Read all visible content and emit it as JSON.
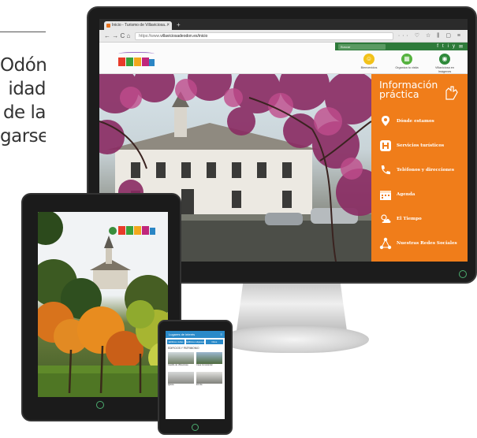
{
  "side_text": {
    "lines": [
      "Odón",
      "idad",
      "de la",
      "garse"
    ]
  },
  "browser": {
    "tab_title": "Inicio - Turismo de Villaviciosa...",
    "tab_close": "×",
    "new_tab": "+",
    "nav_glyphs": "← → C ⌂",
    "url_prefix": "https://www.",
    "url_host": "villaviciosadeodon.es/inicio",
    "tools_glyphs": "··· ♡ ☆   ⫼ ▢ ≡",
    "search_placeholder": "Buscar",
    "utility_icons": [
      "f",
      "t",
      "i",
      "y",
      "✉"
    ]
  },
  "site": {
    "quick_links": [
      {
        "label": "Bienvenidos",
        "icon": "face-icon",
        "color": "#f2c21a"
      },
      {
        "label": "Organiza tu visita",
        "icon": "calendar-icon",
        "color": "#55b23e"
      },
      {
        "label": "Villaviciosa en Imágenes",
        "icon": "camera-icon",
        "color": "#2f8a3b"
      }
    ],
    "info_panel": {
      "title": "Información práctica",
      "items": [
        {
          "label": "Dónde estamos",
          "icon": "location-pin-icon"
        },
        {
          "label": "Servicios turísticos",
          "icon": "hotel-icon"
        },
        {
          "label": "Teléfonos y direcciones",
          "icon": "phone-icon"
        },
        {
          "label": "Agenda",
          "icon": "calendar-icon"
        },
        {
          "label": "El Tiempo",
          "icon": "weather-icon"
        },
        {
          "label": "Nuestras Redes Sociales",
          "icon": "share-icon"
        }
      ]
    },
    "accent_color": "#f07d1a",
    "brand_green": "#2e7a3a"
  },
  "phone": {
    "app_title": "Lugares de interés",
    "chips": [
      "Edificios civiles",
      "Edificios religiosos",
      "Otros"
    ],
    "section_title": "EDIFICIOS Y PATRIMONIO",
    "cards": [
      {
        "caption": "Castillo de Villaviciosa"
      },
      {
        "caption": "Casa Consistorial"
      },
      {
        "caption": "Iglesia"
      },
      {
        "caption": "Ermita"
      }
    ]
  }
}
